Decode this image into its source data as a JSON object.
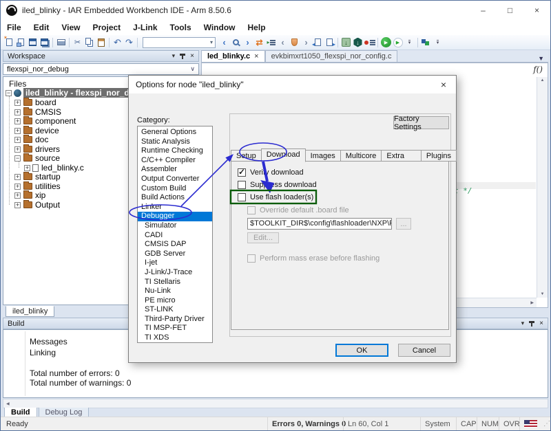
{
  "window": {
    "title": "iled_blinky - IAR Embedded Workbench IDE - Arm 8.50.6"
  },
  "menu": {
    "items": [
      "File",
      "Edit",
      "View",
      "Project",
      "J-Link",
      "Tools",
      "Window",
      "Help"
    ]
  },
  "toolbar": {
    "search_value": "",
    "icons": [
      "new-document",
      "open-document",
      "save",
      "save-all",
      "print",
      "cut",
      "copy",
      "paste",
      "undo",
      "redo",
      "search-combo",
      "nav-back",
      "find",
      "nav-forward",
      "swap",
      "goto-function",
      "bookmark-prev",
      "bookmark-shield",
      "bookmark-next",
      "previous-document",
      "next-document",
      "download-flash",
      "download-and-debug",
      "breakpoints",
      "run",
      "run-without-debug",
      "toolbar-overflow",
      "rtos-blocks",
      "toolbar-overflow-2"
    ]
  },
  "workspace": {
    "title": "Workspace",
    "config": "flexspi_nor_debug",
    "files_header": "Files",
    "root_label": "iled_blinky - flexspi_nor_debug",
    "tree": [
      {
        "label": "board"
      },
      {
        "label": "CMSIS"
      },
      {
        "label": "component"
      },
      {
        "label": "device"
      },
      {
        "label": "doc"
      },
      {
        "label": "drivers"
      },
      {
        "label": "source"
      },
      {
        "label": "led_blinky.c"
      },
      {
        "label": "startup"
      },
      {
        "label": "utilities"
      },
      {
        "label": "xip"
      },
      {
        "label": "Output"
      }
    ],
    "bottom_tab": "iled_blinky"
  },
  "editor": {
    "tabs": [
      {
        "label": "led_blinky.c",
        "close": "x"
      },
      {
        "label": "evkbimxrt1050_flexspi_nor_config.c"
      }
    ],
    "function_icon": "f()",
    "code_fragment": "t */"
  },
  "dialog": {
    "title": "Options for node \"iled_blinky\"",
    "close": "×",
    "category_label": "Category:",
    "categories": [
      "General Options",
      "Static Analysis",
      "Runtime Checking",
      "C/C++ Compiler",
      "Assembler",
      "Output Converter",
      "Custom Build",
      "Build Actions",
      "Linker",
      "Debugger",
      "Simulator",
      "CADI",
      "CMSIS DAP",
      "GDB Server",
      "I-jet",
      "J-Link/J-Trace",
      "TI Stellaris",
      "Nu-Link",
      "PE micro",
      "ST-LINK",
      "Third-Party Driver",
      "TI MSP-FET",
      "TI XDS"
    ],
    "selected_category": "Debugger",
    "factory_settings_label": "Factory Settings",
    "tabs": [
      "Setup",
      "Download",
      "Images",
      "Multicore",
      "Extra Options",
      "Plugins"
    ],
    "active_tab": "Download",
    "download_tab": {
      "verify_label": "Verify download",
      "verify_checked": true,
      "suppress_label": "Suppress download",
      "suppress_checked": false,
      "use_flash_label": "Use flash loader(s)",
      "use_flash_checked": false,
      "override_label": "Override default .board file",
      "override_checked": false,
      "board_file_value": "$TOOLKIT_DIR$\\config\\flashloader\\NXP\\FlashIMXI",
      "browse_label": "...",
      "edit_label": "Edit...",
      "mass_erase_label": "Perform mass erase before flashing",
      "mass_erase_checked": false
    },
    "ok_label": "OK",
    "cancel_label": "Cancel"
  },
  "build": {
    "title": "Build",
    "messages_header": "Messages",
    "lines": [
      "Linking",
      "Total number of errors: 0",
      "Total number of warnings: 0"
    ],
    "tabs": [
      "Build",
      "Debug Log"
    ],
    "active_tab": "Build"
  },
  "statusbar": {
    "ready": "Ready",
    "errors": "Errors 0, Warnings 0",
    "position": "Ln 60, Col 1",
    "system": "System",
    "caps": "CAP",
    "num": "NUM",
    "ovr": "OVR"
  },
  "colors": {
    "selection_blue": "#0078d7",
    "annotation_blue": "#2b2bd0",
    "annotation_green": "#0a5c0a",
    "folder_brown": "#b5702e",
    "run_green": "#27a833"
  }
}
